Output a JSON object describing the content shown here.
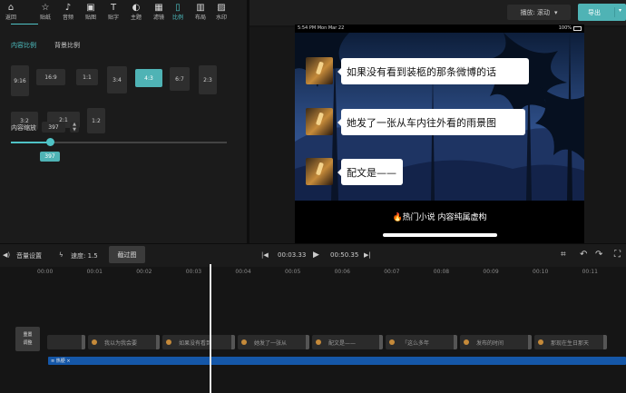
{
  "toolbar": {
    "items": [
      {
        "label": "返回",
        "icon": "back-icon",
        "glyph": "⌂"
      },
      {
        "label": "贴纸",
        "icon": "star-icon",
        "glyph": "☆"
      },
      {
        "label": "音频",
        "icon": "music-icon",
        "glyph": "♪"
      },
      {
        "label": "贴图",
        "icon": "image-icon",
        "glyph": "▣"
      },
      {
        "label": "贴字",
        "icon": "text-icon",
        "glyph": "T"
      },
      {
        "label": "主题",
        "icon": "palette-icon",
        "glyph": "◐"
      },
      {
        "label": "滤镜",
        "icon": "filter-icon",
        "glyph": "▦"
      },
      {
        "label": "比例",
        "icon": "ratio-icon",
        "glyph": "▯"
      },
      {
        "label": "布局",
        "icon": "layout-icon",
        "glyph": "▥"
      },
      {
        "label": "水印",
        "icon": "watermark-icon",
        "glyph": "▨"
      }
    ],
    "active_index": 7
  },
  "panel": {
    "tabs": [
      "内容比例",
      "背景比例"
    ],
    "active_tab": 0,
    "ratios": [
      "9:16",
      "16:9",
      "1:1",
      "3:4",
      "4:3",
      "6:7",
      "2:3",
      "3:2",
      "2:1",
      "1:2"
    ],
    "active_ratio": "4:3",
    "zoom_label": "内容缩放",
    "zoom_value": "397",
    "zoom_bubble": "397",
    "zoom_fraction": 0.18
  },
  "header": {
    "play_mode": "播放: 滚动",
    "export_label": "导出"
  },
  "phone": {
    "status_time": "5:54 PM   Mon Mar 22",
    "status_battery": "100%",
    "messages": [
      "如果没有看到装柩的那条微博的话",
      "她发了一张从车内往外看的雨景图",
      "配文是——"
    ],
    "caption": "🔥热门小说 内容纯属虚构"
  },
  "controls": {
    "volume": "音量设置",
    "speed": "速度: 1.5",
    "speed_box": "截过图",
    "current_time": "00:03.33",
    "total_time": "00:50.35"
  },
  "timeline": {
    "ticks": [
      "00:00",
      "00:01",
      "00:02",
      "00:03",
      "00:04",
      "00:05",
      "00:06",
      "00:07",
      "00:08",
      "00:09",
      "00:10",
      "00:11"
    ],
    "reset_label_1": "重置",
    "reset_label_2": "调整",
    "clips": [
      "",
      "我以为我会要",
      "如果没有看到",
      "她发了一张从",
      "配文是——",
      "「这么多年",
      "发布的时间",
      "那现在生日那天"
    ],
    "audio_label": "≡ 热梗 ×"
  },
  "colors": {
    "accent": "#4fc3c6",
    "export": "#4fb3b5",
    "audio_track": "#1557a8"
  }
}
